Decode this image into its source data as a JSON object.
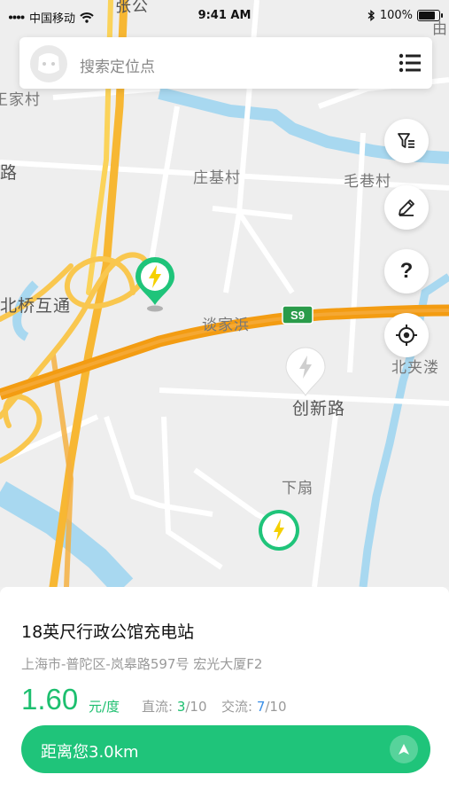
{
  "status_bar": {
    "carrier": "中国移动",
    "time": "9:41 AM",
    "battery": "100%"
  },
  "search": {
    "placeholder": "搜索定位点"
  },
  "map": {
    "labels": {
      "zhang_gong": "张公",
      "wang_jia_cun": "王家村",
      "lu": "路",
      "zhuang_ji_cun": "庄基村",
      "mao_xiang_cun": "毛巷村",
      "bei_qiao_hu_tong": "北桥互通",
      "tan_jia_bang": "谈家浜",
      "highway_badge": "S9",
      "bei_jia_lou": "北夹溇",
      "chuang_xin_lu": "创新路",
      "xia_shan": "下扇",
      "corner": "由"
    },
    "markers": [
      "green-pin-charger",
      "gray-pin-charger",
      "green-circle-charger"
    ]
  },
  "side_buttons": {
    "question": "?"
  },
  "station": {
    "name": "18英尺行政公馆充电站",
    "address": "上海市-普陀区-岚皋路597号 宏光大厦F2",
    "price": "1.60",
    "price_unit": "元/度",
    "dc_label": "直流: ",
    "dc_available": "3",
    "dc_total": "/10",
    "ac_label": "交流: ",
    "ac_available": "7",
    "ac_total": "/10",
    "distance_label": "距离您3.0km"
  },
  "colors": {
    "accent": "#1fc47a",
    "ac_blue": "#3a8fe8",
    "road_orange": "#f39c12",
    "road_yellow": "#f9c74f",
    "water": "#a8d8f0"
  }
}
